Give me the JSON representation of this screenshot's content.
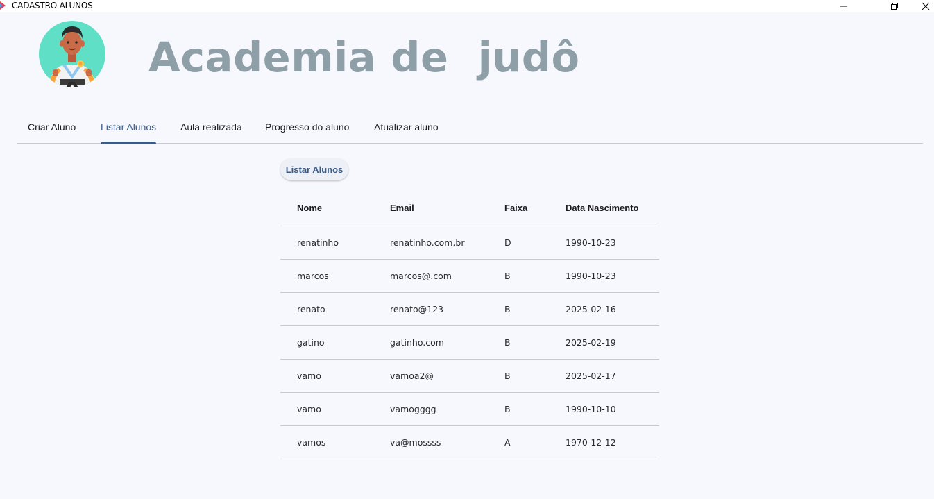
{
  "window": {
    "title": "CADASTRO ALUNOS",
    "app_icon": "app-icon",
    "controls": [
      "minimize-icon",
      "restore-icon",
      "close-icon"
    ]
  },
  "header": {
    "avatar": "judoka-avatar",
    "title": "Academia de  judô"
  },
  "tabs": [
    {
      "label": "Criar Aluno",
      "active": false
    },
    {
      "label": "Listar Alunos",
      "active": true
    },
    {
      "label": "Aula realizada",
      "active": false
    },
    {
      "label": "Progresso do aluno",
      "active": false
    },
    {
      "label": "Atualizar aluno",
      "active": false
    }
  ],
  "list_button": {
    "label": "Listar Alunos"
  },
  "table": {
    "columns": [
      "Nome",
      "Email",
      "Faixa",
      "Data Nascimento"
    ],
    "rows": [
      [
        "renatinho",
        "renatinho.com.br",
        "D",
        "1990-10-23"
      ],
      [
        "marcos",
        "marcos@.com",
        "B",
        "1990-10-23"
      ],
      [
        "renato",
        "renato@123",
        "B",
        "2025-02-16"
      ],
      [
        "gatino",
        "gatinho.com",
        "B",
        "2025-02-19"
      ],
      [
        "vamo",
        "vamoa2@",
        "B",
        "2025-02-17"
      ],
      [
        "vamo",
        "vamogggg",
        "B",
        "1990-10-10"
      ],
      [
        "vamos",
        "va@mossss",
        "A",
        "1970-12-12"
      ]
    ]
  },
  "colors": {
    "background": "#f7f8fd",
    "accent": "#3a5b85",
    "heading": "#8e9fa8",
    "divider": "#c8c9d0"
  }
}
